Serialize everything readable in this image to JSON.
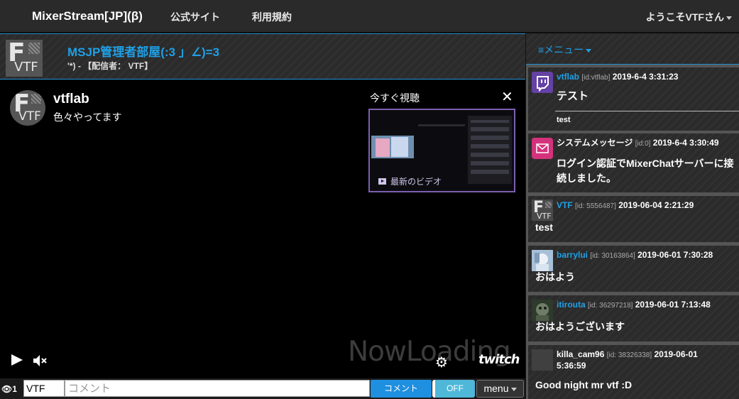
{
  "nav": {
    "brand": "MixerStream[JP](β)",
    "official_site": "公式サイト",
    "terms": "利用規約",
    "welcome": "ようこそVTFさん"
  },
  "channel": {
    "room_title": "MSJP管理者部屋(:3 」∠)=3",
    "room_sub": "'*) - 【配信者： VTF】"
  },
  "player": {
    "channel_name": "vtflab",
    "channel_desc": "色々やってます",
    "watch_now": "今すぐ視聴",
    "close_glyph": "✕",
    "latest_video": "最新のビデオ",
    "loading_text": "NowLoading",
    "twitch_logo": "twitch"
  },
  "bottom": {
    "viewer_count": "1",
    "name_value": "VTF",
    "comment_placeholder": "コメント",
    "comment_button": "コメント",
    "toggle_label": "OFF",
    "menu_button": "menu"
  },
  "sidebar": {
    "menu_label": "≡メニュー",
    "messages": [
      {
        "user": "vtflab",
        "id": "[id:vtflab]",
        "time": "2019-6-4 3:31:23",
        "title": "テスト",
        "body": "test",
        "avatar": "twitch-icon"
      },
      {
        "user": "システムメッセージ",
        "id": "[id:0]",
        "time": "2019-6-4 3:30:49",
        "body": "ログイン認証でMixerChatサーバーに接続しました。",
        "avatar": "mail-icon"
      },
      {
        "user": "VTF",
        "id": "[id: 5556487]",
        "time": "2019-06-04 2:21:29",
        "body": "test",
        "avatar": "vtf-logo"
      },
      {
        "user": "barrylui",
        "id": "[id: 30163864]",
        "time": "2019-06-01 7:30:28",
        "body": "おはよう",
        "avatar": "user-avatar"
      },
      {
        "user": "itirouta",
        "id": "[id: 36297218]",
        "time": "2019-06-01 7:13:48",
        "body": "おはようございます",
        "avatar": "user-avatar"
      },
      {
        "user": "killa_cam96",
        "id": "[id: 38326338]",
        "time": "2019-06-01 5:36:59",
        "body": "Good night mr vtf :D",
        "avatar": "user-avatar"
      }
    ]
  },
  "colors": {
    "accent": "#1fa0e6",
    "twitch_purple": "#6441a4",
    "comment_button": "#1f8fe0",
    "toggle": "#4fb7d8"
  }
}
